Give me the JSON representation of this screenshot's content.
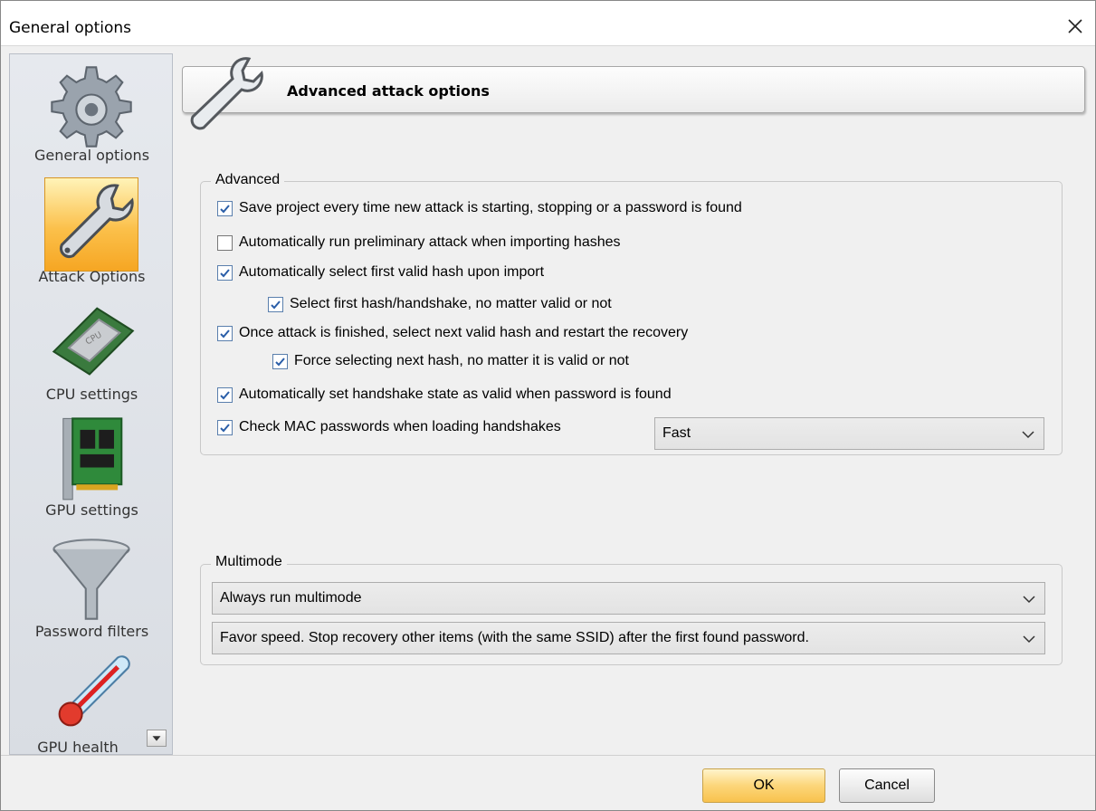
{
  "window": {
    "title": "General options"
  },
  "sidebar": {
    "items": [
      {
        "label": "General options",
        "icon": "gear-icon",
        "selected": false
      },
      {
        "label": "Attack Options",
        "icon": "wrench-icon",
        "selected": true
      },
      {
        "label": "CPU settings",
        "icon": "cpu-chip-icon",
        "selected": false
      },
      {
        "label": "GPU settings",
        "icon": "gpu-card-icon",
        "selected": false
      },
      {
        "label": "Password  filters",
        "icon": "funnel-icon",
        "selected": false
      },
      {
        "label": "GPU health",
        "icon": "thermometer-icon",
        "selected": false
      }
    ]
  },
  "header": {
    "title": "Advanced attack options",
    "icon": "wrench-icon"
  },
  "advanced": {
    "legend": "Advanced",
    "options": [
      {
        "label": "Save project every time new attack is starting, stopping or a password is found",
        "checked": true
      },
      {
        "label": "Automatically run preliminary attack when importing hashes",
        "checked": false
      },
      {
        "label": "Automatically select first valid hash upon import",
        "checked": true
      },
      {
        "label": "Select first hash/handshake, no matter valid or not",
        "checked": true
      },
      {
        "label": "Once attack is finished, select next valid hash and restart the recovery",
        "checked": true
      },
      {
        "label": "Force selecting next hash, no matter it is valid or not",
        "checked": true
      },
      {
        "label": "Automatically set handshake state as valid when password is found",
        "checked": true
      },
      {
        "label": "Check MAC passwords when loading handshakes",
        "checked": true
      }
    ],
    "mac_mode": "Fast"
  },
  "multimode": {
    "legend": "Multimode",
    "mode": "Always run multimode",
    "strategy": "Favor speed. Stop recovery other items (with the same SSID) after the first found password."
  },
  "buttons": {
    "ok": "OK",
    "cancel": "Cancel"
  },
  "colors": {
    "selected_nav": "#fbc04a",
    "ok_button": "#fcd67a",
    "check_accent": "#2a5ea8"
  }
}
